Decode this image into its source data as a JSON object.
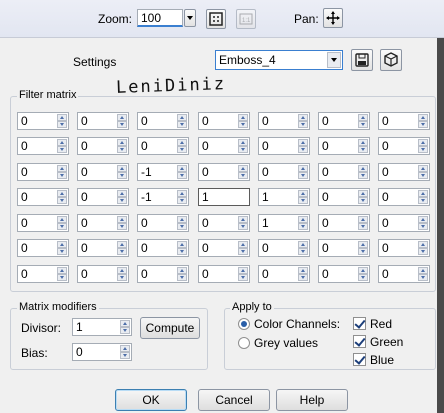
{
  "top": {
    "zoom_label": "Zoom:",
    "zoom_value": "100",
    "pan_label": "Pan:",
    "zoom_actual_icon": "actual-size-icon",
    "zoom_fit_icon": "fit-window-icon",
    "pan_icon": "move-cross-icon"
  },
  "settings": {
    "label": "Settings",
    "preset_value": "Emboss_4",
    "save_icon": "save-icon",
    "manage_icon": "presets-icon"
  },
  "watermark": {
    "text": "LeniDiniz"
  },
  "filter_matrix": {
    "title": "Filter matrix",
    "rows": [
      [
        "0",
        "0",
        "0",
        "0",
        "0",
        "0",
        "0"
      ],
      [
        "0",
        "0",
        "0",
        "0",
        "0",
        "0",
        "0"
      ],
      [
        "0",
        "0",
        "-1",
        "0",
        "0",
        "0",
        "0"
      ],
      [
        "0",
        "0",
        "-1",
        "1",
        "1",
        "0",
        "0"
      ],
      [
        "0",
        "0",
        "0",
        "0",
        "1",
        "0",
        "0"
      ],
      [
        "0",
        "0",
        "0",
        "0",
        "0",
        "0",
        "0"
      ],
      [
        "0",
        "0",
        "0",
        "0",
        "0",
        "0",
        "0"
      ]
    ]
  },
  "modifiers": {
    "title": "Matrix modifiers",
    "divisor_label": "Divisor:",
    "divisor_value": "1",
    "compute_label": "Compute",
    "bias_label": "Bias:",
    "bias_value": "0"
  },
  "apply_to": {
    "title": "Apply to",
    "color_channels_label": "Color Channels:",
    "grey_values_label": "Grey values",
    "red_label": "Red",
    "green_label": "Green",
    "blue_label": "Blue"
  },
  "buttons": {
    "ok": "OK",
    "cancel": "Cancel",
    "help": "Help"
  }
}
